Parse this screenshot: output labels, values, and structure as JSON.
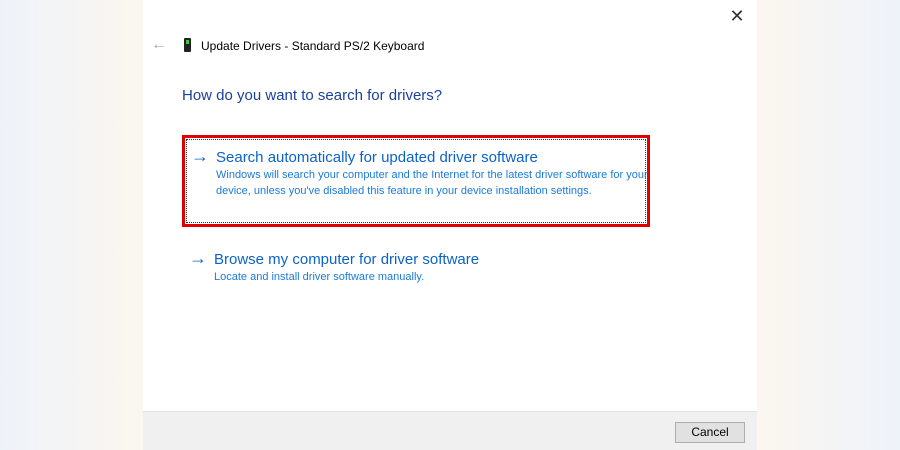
{
  "window": {
    "title": "Update Drivers - Standard PS/2 Keyboard",
    "close_label": "✕",
    "back_label": "←"
  },
  "heading": "How do you want to search for drivers?",
  "options": [
    {
      "arrow": "→",
      "title": "Search automatically for updated driver software",
      "description": "Windows will search your computer and the Internet for the latest driver software for your device, unless you've disabled this feature in your device installation settings."
    },
    {
      "arrow": "→",
      "title": "Browse my computer for driver software",
      "description": "Locate and install driver software manually."
    }
  ],
  "footer": {
    "cancel_label": "Cancel"
  },
  "colors": {
    "accent": "#0b63c7",
    "highlight": "#e00000"
  }
}
